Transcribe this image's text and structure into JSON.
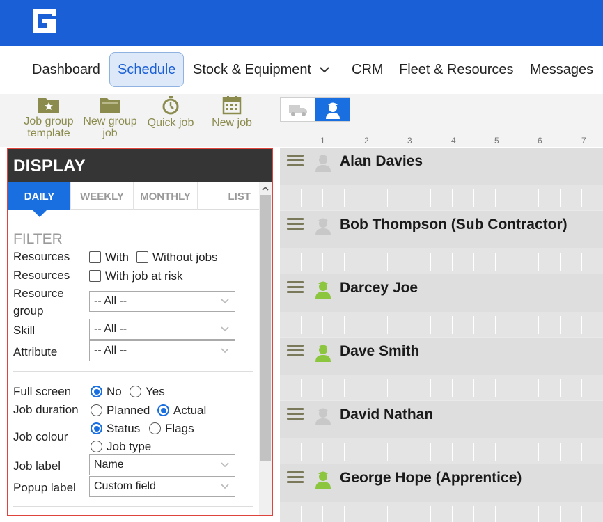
{
  "nav": {
    "items": [
      {
        "label": "Dashboard"
      },
      {
        "label": "Schedule",
        "active": true
      },
      {
        "label": "Stock & Equipment",
        "has_dropdown": true
      },
      {
        "label": "CRM"
      },
      {
        "label": "Fleet & Resources"
      },
      {
        "label": "Messages"
      }
    ]
  },
  "toolbar": {
    "job_group_template_line1": "Job group",
    "job_group_template_line2": "template",
    "new_group_job_line1": "New group",
    "new_group_job_line2": "job",
    "quick_job": "Quick job",
    "new_job": "New job"
  },
  "ruler": [
    "1",
    "2",
    "3",
    "4",
    "5",
    "6",
    "7"
  ],
  "display": {
    "title": "DISPLAY",
    "tabs": [
      {
        "label": "DAILY",
        "active": true
      },
      {
        "label": "WEEKLY"
      },
      {
        "label": "MONTHLY"
      },
      {
        "label": "LIST"
      }
    ],
    "filter_title": "FILTER",
    "resources_label_1": "Resources",
    "with_label": "With",
    "without_jobs_label": "Without jobs",
    "resources_label_2": "Resources",
    "with_job_at_risk_label": "With job at risk",
    "resource_group_label_line1": "Resource",
    "resource_group_label_line2": "group",
    "resource_group_value": "-- All --",
    "skill_label": "Skill",
    "skill_value": "-- All --",
    "attribute_label": "Attribute",
    "attribute_value": "-- All --",
    "full_screen_label": "Full screen",
    "full_screen_no": "No",
    "full_screen_yes": "Yes",
    "full_screen_selected": "No",
    "job_duration_label": "Job duration",
    "job_duration_planned": "Planned",
    "job_duration_actual": "Actual",
    "job_duration_selected": "Actual",
    "job_colour_label": "Job colour",
    "job_colour_status": "Status",
    "job_colour_flags": "Flags",
    "job_colour_job_type": "Job type",
    "job_colour_selected": "Status",
    "job_label_label": "Job label",
    "job_label_value": "Name",
    "popup_label_label": "Popup label",
    "popup_label_value": "Custom field"
  },
  "resources": [
    {
      "name": "Alan Davies",
      "status": "inactive"
    },
    {
      "name": "Bob Thompson (Sub Contractor)",
      "status": "inactive"
    },
    {
      "name": "Darcey Joe",
      "status": "active"
    },
    {
      "name": "Dave Smith",
      "status": "active"
    },
    {
      "name": "David Nathan",
      "status": "inactive"
    },
    {
      "name": "George Hope (Apprentice)",
      "status": "active"
    }
  ],
  "colors": {
    "brand_blue": "#1a5fd6",
    "accent_blue": "#1a6fe0",
    "panel_border": "#e0433c",
    "active_person": "#8cc63f",
    "inactive_person": "#c8c8c8",
    "tool_olive": "#8b8b4e"
  }
}
